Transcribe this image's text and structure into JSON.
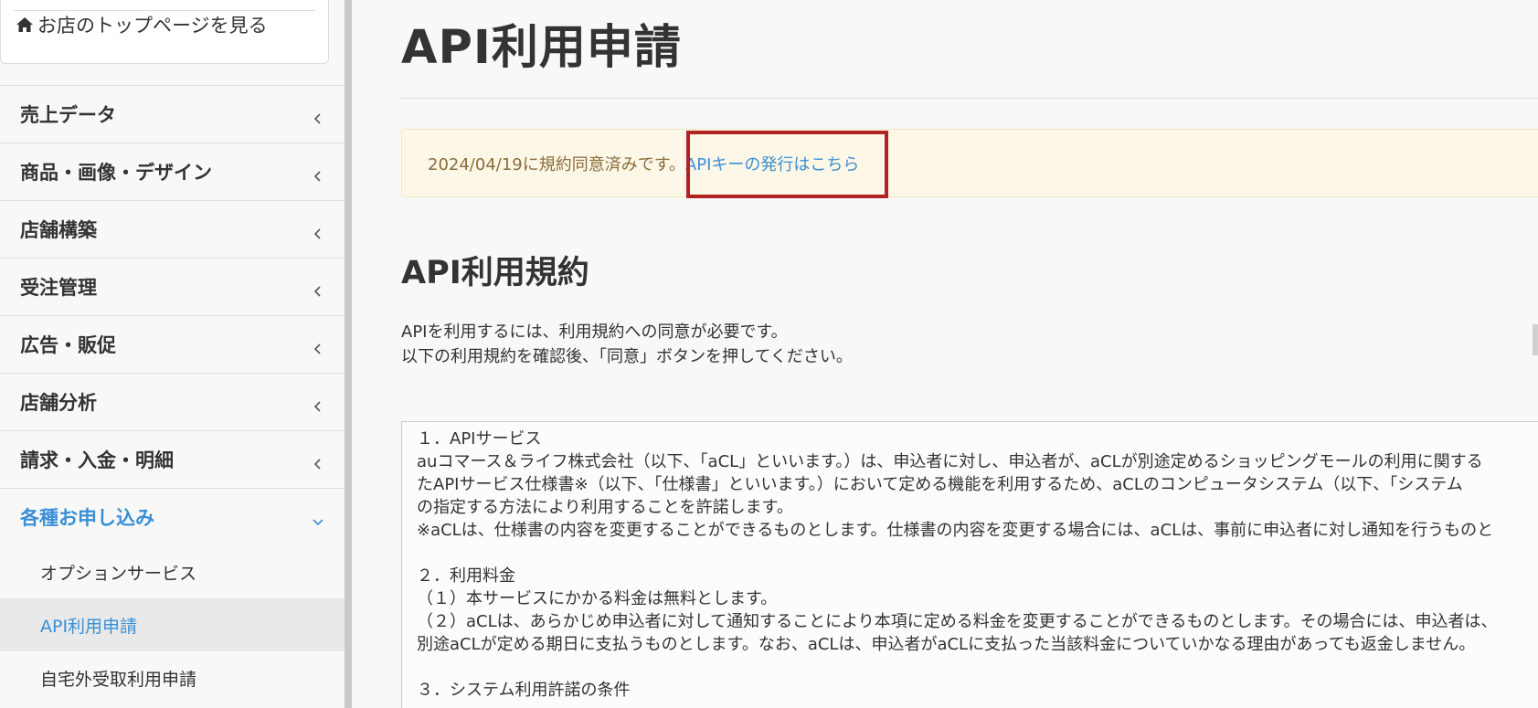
{
  "sidebar": {
    "top_link": {
      "icon": "home-icon",
      "label": "お店のトップページを見る"
    },
    "nav": [
      {
        "label": "売上データ",
        "chevron": "chevron-left-icon",
        "expanded": false
      },
      {
        "label": "商品・画像・デザイン",
        "chevron": "chevron-left-icon",
        "expanded": false
      },
      {
        "label": "店舗構築",
        "chevron": "chevron-left-icon",
        "expanded": false
      },
      {
        "label": "受注管理",
        "chevron": "chevron-left-icon",
        "expanded": false
      },
      {
        "label": "広告・販促",
        "chevron": "chevron-left-icon",
        "expanded": false
      },
      {
        "label": "店舗分析",
        "chevron": "chevron-left-icon",
        "expanded": false
      },
      {
        "label": "請求・入金・明細",
        "chevron": "chevron-left-icon",
        "expanded": false
      },
      {
        "label": "各種お申し込み",
        "chevron": "chevron-down-icon",
        "expanded": true
      }
    ],
    "sub_items": [
      {
        "label": "オプションサービス",
        "active": false
      },
      {
        "label": "API利用申請",
        "active": true
      },
      {
        "label": "自宅外受取利用申請",
        "active": false
      }
    ]
  },
  "main": {
    "title": "API利用申請",
    "notice": {
      "text": "2024/04/19に規約同意済みです。",
      "link_label": "APIキーの発行はこちら"
    },
    "section_title": "API利用規約",
    "intro": [
      "APIを利用するには、利用規約への同意が必要です。",
      "以下の利用規約を確認後、「同意」ボタンを押してください。"
    ],
    "terms": [
      "１．APIサービス",
      "auコマース＆ライフ株式会社（以下、「aCL」といいます。）は、申込者に対し、申込者が、aCLが別途定めるショッピングモールの利用に関する",
      "たAPIサービス仕様書※（以下、「仕様書」といいます。）において定める機能を利用するため、aCLのコンピュータシステム（以下、「システム",
      "の指定する方法により利用することを許諾します。",
      "※aCLは、仕様書の内容を変更することができるものとします。仕様書の内容を変更する場合には、aCLは、事前に申込者に対し通知を行うものと",
      "",
      "２．利用料金",
      "（１）本サービスにかかる料金は無料とします。",
      "（２）aCLは、あらかじめ申込者に対して通知することにより本項に定める料金を変更することができるものとします。その場合には、申込者は、",
      "別途aCLが定める期日に支払うものとします。なお、aCLは、申込者がaCLに支払った当該料金についていかなる理由があっても返金しません。",
      "",
      "３．システム利用許諾の条件"
    ]
  },
  "colors": {
    "accent": "#3a8fd6",
    "notice_bg": "#fcf7e6",
    "notice_text": "#8a6d3b",
    "highlight": "#b22222"
  }
}
